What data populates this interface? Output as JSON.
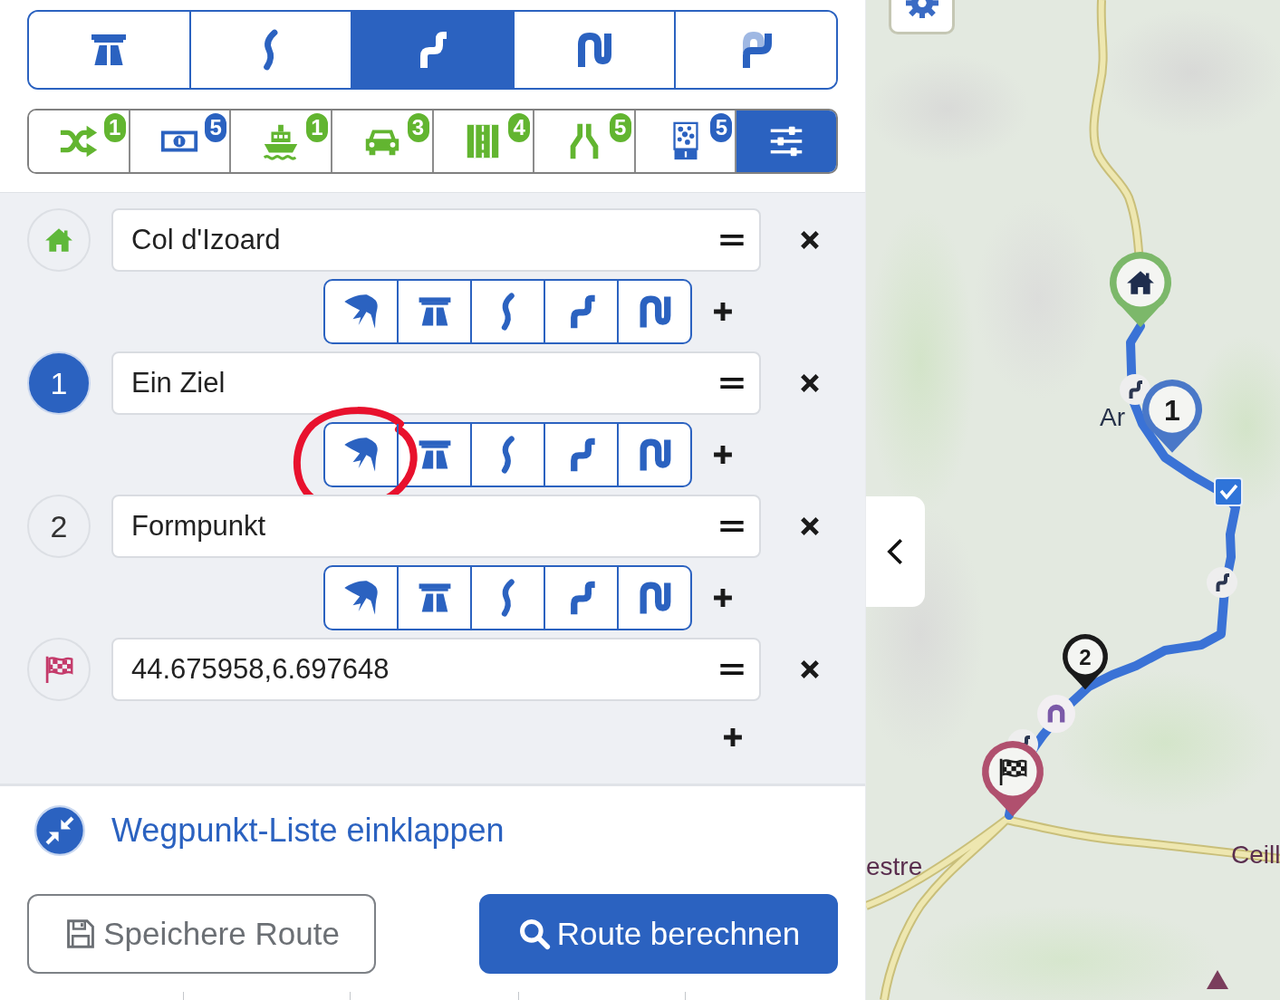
{
  "route_types": [
    {
      "kind": "motorway",
      "selected": false
    },
    {
      "kind": "wavy",
      "selected": false
    },
    {
      "kind": "winding",
      "selected": true
    },
    {
      "kind": "hairpin",
      "selected": false
    },
    {
      "kind": "extreme",
      "selected": false
    }
  ],
  "options": [
    {
      "kind": "shuffle",
      "badge": "1",
      "color": "#62b530",
      "selected": false
    },
    {
      "kind": "banknote",
      "badge": "5",
      "color": "#2b62c0",
      "selected": false
    },
    {
      "kind": "ferry",
      "badge": "1",
      "color": "#62b530",
      "selected": false
    },
    {
      "kind": "car",
      "badge": "3",
      "color": "#62b530",
      "selected": false
    },
    {
      "kind": "road",
      "badge": "4",
      "color": "#62b530",
      "selected": false
    },
    {
      "kind": "narrowing",
      "badge": "5",
      "color": "#62b530",
      "selected": false
    },
    {
      "kind": "dots",
      "badge": "5",
      "color": "#2b62c0",
      "selected": false
    },
    {
      "kind": "sliders",
      "selected": true
    }
  ],
  "waypoints": [
    {
      "kind": "start",
      "selected": false,
      "value": "Col d'Izoard",
      "profiles": [
        {
          "kind": "bird",
          "circled": false
        },
        {
          "kind": "motorway",
          "circled": false
        },
        {
          "kind": "wavy",
          "circled": false
        },
        {
          "kind": "winding",
          "circled": false
        },
        {
          "kind": "hairpin",
          "circled": false
        }
      ]
    },
    {
      "kind": "via",
      "number": "1",
      "selected": true,
      "value": "Ein Ziel",
      "profiles": [
        {
          "kind": "bird",
          "circled": true
        },
        {
          "kind": "motorway",
          "circled": false
        },
        {
          "kind": "wavy",
          "circled": false
        },
        {
          "kind": "winding",
          "circled": false
        },
        {
          "kind": "hairpin",
          "circled": false
        }
      ]
    },
    {
      "kind": "via",
      "number": "2",
      "selected": false,
      "value": "Formpunkt",
      "profiles": [
        {
          "kind": "bird",
          "circled": false
        },
        {
          "kind": "motorway",
          "circled": false
        },
        {
          "kind": "wavy",
          "circled": false
        },
        {
          "kind": "winding",
          "circled": false
        },
        {
          "kind": "hairpin",
          "circled": false
        }
      ]
    },
    {
      "kind": "finish",
      "selected": false,
      "value": "44.675958,6.697648"
    }
  ],
  "collapse_link": "Wegpunkt-Liste einklappen",
  "buttons": [
    {
      "kind": "save",
      "label": "Speichere Route"
    },
    {
      "kind": "calculate",
      "label": "Route berechnen"
    }
  ],
  "map": {
    "markers": [
      {
        "kind": "start"
      },
      {
        "kind": "via",
        "label": "1",
        "selected": true
      },
      {
        "kind": "via",
        "label": "2",
        "selected": false
      },
      {
        "kind": "finish"
      }
    ],
    "pois": [
      {
        "kind": "winding"
      },
      {
        "kind": "check"
      },
      {
        "kind": "winding"
      },
      {
        "kind": "tunnel"
      },
      {
        "kind": "winding"
      },
      {
        "kind": "peak"
      }
    ],
    "place_labels": [
      "Ar",
      "estre",
      "Ceill"
    ]
  }
}
